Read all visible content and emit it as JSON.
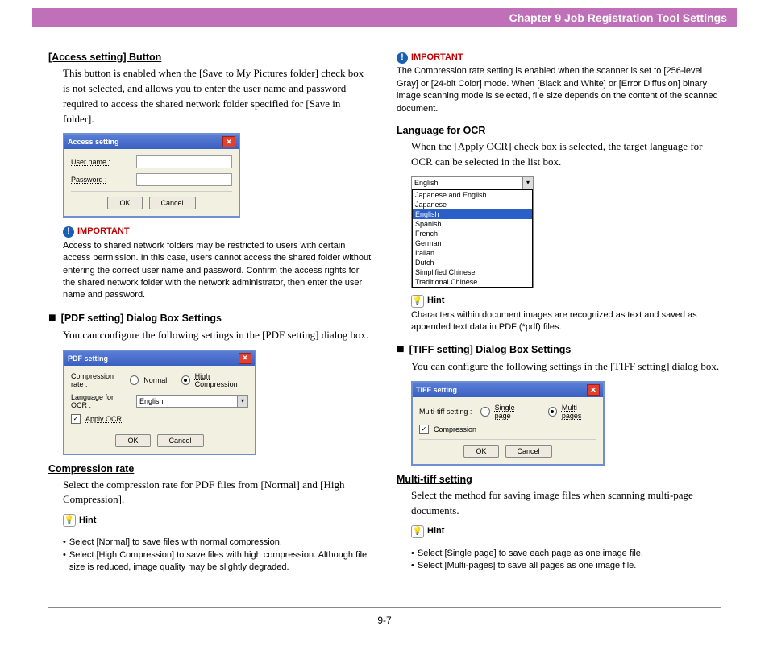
{
  "header": "Chapter 9   Job Registration Tool Settings",
  "page_number": "9-7",
  "left": {
    "access_setting": {
      "title": "[Access setting] Button",
      "body": "This button is enabled when the [Save to My Pictures folder] check box is not selected, and allows you to enter the user name and password required to access the shared network folder specified for [Save in folder].",
      "dialog": {
        "title": "Access setting",
        "user_label": "User name :",
        "pass_label": "Password :",
        "ok": "OK",
        "cancel": "Cancel"
      },
      "important": "Access to shared network folders may be restricted to users with certain access permission. In this case, users cannot access the shared folder without entering the correct user name and password. Confirm the access rights for the shared network folder with the network administrator, then enter the user name and password."
    },
    "pdf": {
      "title": "[PDF setting] Dialog Box Settings",
      "body": "You can configure the following settings in the [PDF setting] dialog box.",
      "dialog": {
        "title": "PDF setting",
        "rate_label": "Compression rate :",
        "normal": "Normal",
        "high": "High Compression",
        "lang_label": "Language for OCR :",
        "lang_value": "English",
        "ocr": "Apply OCR",
        "ok": "OK",
        "cancel": "Cancel"
      }
    },
    "compression": {
      "title": "Compression rate",
      "body": "Select the compression rate for PDF files from [Normal] and [High Compression].",
      "hint1": "Select [Normal] to save files with normal compression.",
      "hint2": "Select [High Compression] to save files with high compression. Although file size is reduced, image quality may be slightly degraded."
    }
  },
  "right": {
    "important": "The Compression rate setting is enabled when the scanner is set to [256-level Gray] or [24-bit Color] mode. When [Black and White] or [Error Diffusion] binary image scanning mode is selected, file size depends on the content of the scanned document.",
    "lang": {
      "title": "Language for OCR",
      "body": "When the [Apply OCR] check box is selected, the target language for OCR can be selected in the list box.",
      "listbox": {
        "value": "English",
        "opts": [
          "Japanese and English",
          "Japanese",
          "English",
          "Spanish",
          "French",
          "German",
          "Italian",
          "Dutch",
          "Simplified Chinese",
          "Traditional Chinese"
        ]
      },
      "hint": "Characters within document images are recognized as text and saved as appended text data in PDF (*pdf) files."
    },
    "tiff": {
      "title": "[TIFF setting] Dialog Box Settings",
      "body": "You can configure the following settings in the [TIFF setting] dialog box.",
      "dialog": {
        "title": "TIFF setting",
        "multi_label": "Multi-tiff setting :",
        "single": "Single page",
        "multi": "Multi pages",
        "comp": "Compression",
        "ok": "OK",
        "cancel": "Cancel"
      }
    },
    "multi": {
      "title": "Multi-tiff setting",
      "body": "Select the method for saving image files when scanning multi-page documents.",
      "hint1": "Select [Single page] to save each page as one image file.",
      "hint2": "Select [Multi-pages] to save all pages as one image file."
    }
  },
  "labels": {
    "important": "IMPORTANT",
    "hint": "Hint"
  }
}
